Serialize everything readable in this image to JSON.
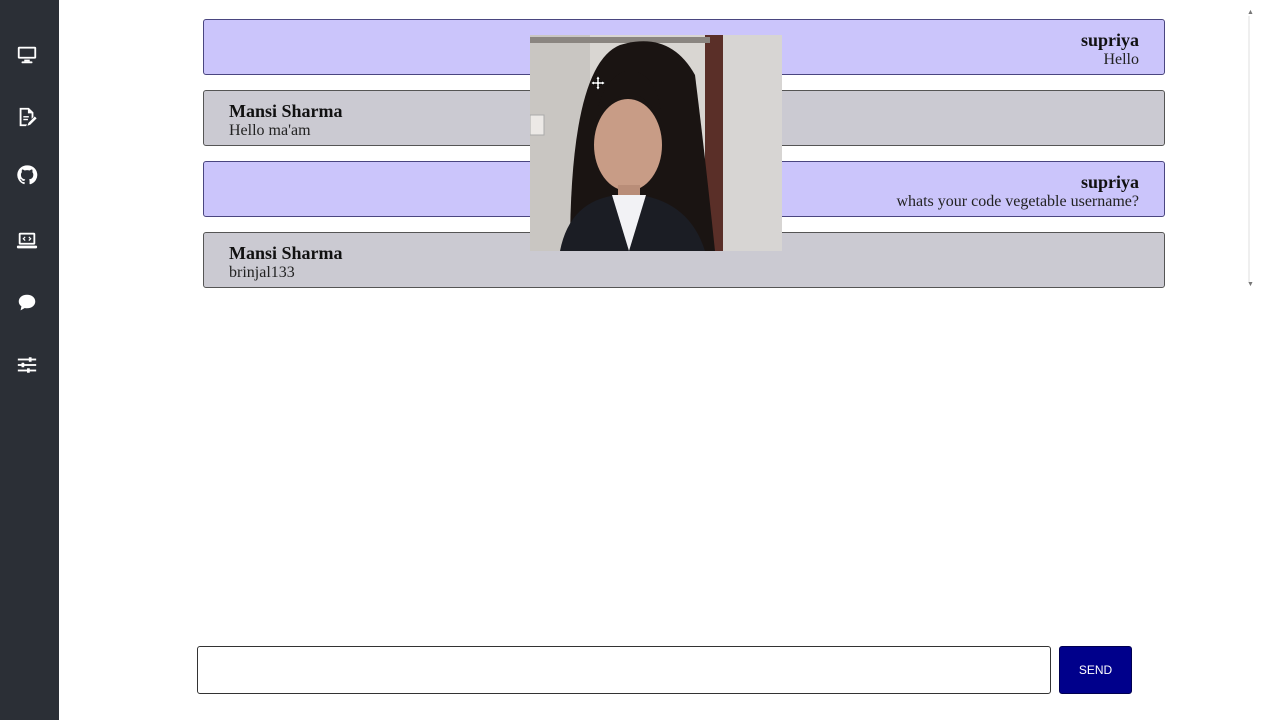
{
  "sidebar": {
    "items": [
      {
        "icon": "monitor-icon"
      },
      {
        "icon": "edit-document-icon"
      },
      {
        "icon": "github-icon"
      },
      {
        "icon": "code-laptop-icon"
      },
      {
        "icon": "chat-bubble-icon"
      },
      {
        "icon": "sliders-icon"
      }
    ],
    "background": "#2b2f36"
  },
  "messages": [
    {
      "sender": "supriya",
      "text": "Hello",
      "self": true
    },
    {
      "sender": "Mansi Sharma",
      "text": "Hello ma'am",
      "self": false
    },
    {
      "sender": "supriya",
      "text": "whats your code vegetable username?",
      "self": true
    },
    {
      "sender": "Mansi Sharma",
      "text": "brinjal133",
      "self": false
    }
  ],
  "colors": {
    "self_bubble": "#cbc5fb",
    "other_bubble": "#cbcad2",
    "send_button": "#00008b"
  },
  "video": {
    "icon": "move-cursor-icon"
  },
  "composer": {
    "value": "",
    "placeholder": ""
  },
  "send_label": "SEND"
}
